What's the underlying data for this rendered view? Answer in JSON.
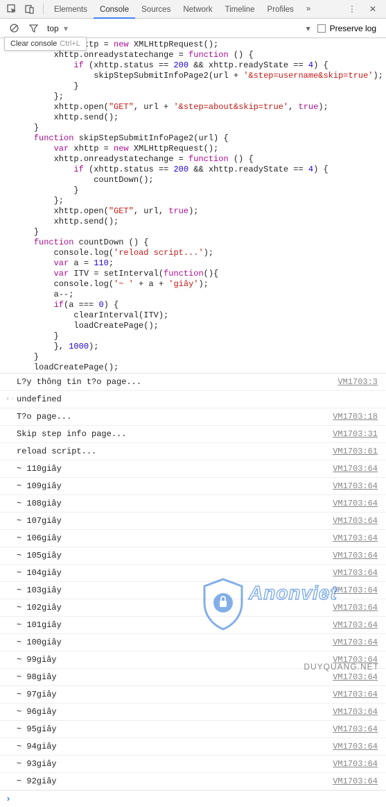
{
  "tabs": [
    "Elements",
    "Console",
    "Sources",
    "Network",
    "Timeline",
    "Profiles"
  ],
  "activeTab": 1,
  "toolbar": {
    "context": "top",
    "preserve_label": "Preserve log",
    "tooltip_label": "Clear console",
    "tooltip_shortcut": "Ctrl+L"
  },
  "code_lines": [
    {
      "indent": 2,
      "frags": [
        {
          "t": "var",
          "c": "kw"
        },
        {
          "t": " xhttp = "
        },
        {
          "t": "new",
          "c": "kw"
        },
        {
          "t": " XMLHttpRequest();"
        }
      ]
    },
    {
      "indent": 2,
      "frags": [
        {
          "t": "xhttp.onreadystatechange = "
        },
        {
          "t": "function",
          "c": "kw"
        },
        {
          "t": " () {"
        }
      ]
    },
    {
      "indent": 3,
      "frags": [
        {
          "t": "if",
          "c": "kw"
        },
        {
          "t": " (xhttp.status == "
        },
        {
          "t": "200",
          "c": "num"
        },
        {
          "t": " && xhttp.readyState == "
        },
        {
          "t": "4",
          "c": "num"
        },
        {
          "t": ") {"
        }
      ]
    },
    {
      "indent": 4,
      "frags": [
        {
          "t": "skipStepSubmitInfoPage2(url + "
        },
        {
          "t": "'&step=username&skip=true'",
          "c": "str"
        },
        {
          "t": ");"
        }
      ]
    },
    {
      "indent": 3,
      "frags": [
        {
          "t": "}"
        }
      ]
    },
    {
      "indent": 2,
      "frags": [
        {
          "t": "};"
        }
      ]
    },
    {
      "indent": 2,
      "frags": [
        {
          "t": "xhttp.open("
        },
        {
          "t": "\"GET\"",
          "c": "str"
        },
        {
          "t": ", url + "
        },
        {
          "t": "'&step=about&skip=true'",
          "c": "str"
        },
        {
          "t": ", "
        },
        {
          "t": "true",
          "c": "kw"
        },
        {
          "t": ");"
        }
      ]
    },
    {
      "indent": 2,
      "frags": [
        {
          "t": "xhttp.send();"
        }
      ]
    },
    {
      "indent": 1,
      "frags": [
        {
          "t": "}"
        }
      ]
    },
    {
      "indent": 1,
      "frags": [
        {
          "t": "function",
          "c": "kw"
        },
        {
          "t": " skipStepSubmitInfoPage2(url) {"
        }
      ]
    },
    {
      "indent": 2,
      "frags": [
        {
          "t": "var",
          "c": "kw"
        },
        {
          "t": " xhttp = "
        },
        {
          "t": "new",
          "c": "kw"
        },
        {
          "t": " XMLHttpRequest();"
        }
      ]
    },
    {
      "indent": 2,
      "frags": [
        {
          "t": "xhttp.onreadystatechange = "
        },
        {
          "t": "function",
          "c": "kw"
        },
        {
          "t": " () {"
        }
      ]
    },
    {
      "indent": 3,
      "frags": [
        {
          "t": "if",
          "c": "kw"
        },
        {
          "t": " (xhttp.status == "
        },
        {
          "t": "200",
          "c": "num"
        },
        {
          "t": " && xhttp.readyState == "
        },
        {
          "t": "4",
          "c": "num"
        },
        {
          "t": ") {"
        }
      ]
    },
    {
      "indent": 4,
      "frags": [
        {
          "t": "countDown();"
        }
      ]
    },
    {
      "indent": 3,
      "frags": [
        {
          "t": "}"
        }
      ]
    },
    {
      "indent": 2,
      "frags": [
        {
          "t": "};"
        }
      ]
    },
    {
      "indent": 2,
      "frags": [
        {
          "t": "xhttp.open("
        },
        {
          "t": "\"GET\"",
          "c": "str"
        },
        {
          "t": ", url, "
        },
        {
          "t": "true",
          "c": "kw"
        },
        {
          "t": ");"
        }
      ]
    },
    {
      "indent": 2,
      "frags": [
        {
          "t": "xhttp.send();"
        }
      ]
    },
    {
      "indent": 1,
      "frags": [
        {
          "t": "}"
        }
      ]
    },
    {
      "indent": 1,
      "frags": [
        {
          "t": "function",
          "c": "kw"
        },
        {
          "t": " countDown () {"
        }
      ]
    },
    {
      "indent": 2,
      "frags": [
        {
          "t": "console.log("
        },
        {
          "t": "'reload script...'",
          "c": "str"
        },
        {
          "t": ");"
        }
      ]
    },
    {
      "indent": 2,
      "frags": [
        {
          "t": "var",
          "c": "kw"
        },
        {
          "t": " a = "
        },
        {
          "t": "110",
          "c": "num"
        },
        {
          "t": ";"
        }
      ]
    },
    {
      "indent": 2,
      "frags": [
        {
          "t": "var",
          "c": "kw"
        },
        {
          "t": " ITV = setInterval("
        },
        {
          "t": "function",
          "c": "kw"
        },
        {
          "t": "(){"
        }
      ]
    },
    {
      "indent": 2,
      "frags": [
        {
          "t": "console.log("
        },
        {
          "t": "'~ '",
          "c": "str"
        },
        {
          "t": " + a + "
        },
        {
          "t": "'giây'",
          "c": "str"
        },
        {
          "t": ");"
        }
      ]
    },
    {
      "indent": 2,
      "frags": [
        {
          "t": "a--;"
        }
      ]
    },
    {
      "indent": 2,
      "frags": [
        {
          "t": "if",
          "c": "kw"
        },
        {
          "t": "(a === "
        },
        {
          "t": "0",
          "c": "num"
        },
        {
          "t": ") {"
        }
      ]
    },
    {
      "indent": 3,
      "frags": [
        {
          "t": "clearInterval(ITV);"
        }
      ]
    },
    {
      "indent": 3,
      "frags": [
        {
          "t": "loadCreatePage();"
        }
      ]
    },
    {
      "indent": 2,
      "frags": [
        {
          "t": "}"
        }
      ]
    },
    {
      "indent": 2,
      "frags": [
        {
          "t": "}, "
        },
        {
          "t": "1000",
          "c": "num"
        },
        {
          "t": ");"
        }
      ]
    },
    {
      "indent": 1,
      "frags": [
        {
          "t": "}"
        }
      ]
    },
    {
      "indent": 1,
      "frags": [
        {
          "t": "loadCreatePage();"
        }
      ]
    }
  ],
  "console": [
    {
      "msg": "L?y thông tin t?o page...",
      "src": "VM1703:3",
      "type": "log",
      "first": true
    },
    {
      "msg": "undefined",
      "src": "",
      "type": "ret"
    },
    {
      "msg": "T?o page...",
      "src": "VM1703:18",
      "type": "log"
    },
    {
      "msg": "Skip step info page...",
      "src": "VM1703:31",
      "type": "log"
    },
    {
      "msg": "reload script...",
      "src": "VM1703:61",
      "type": "log"
    },
    {
      "msg": "~ 110giây",
      "src": "VM1703:64",
      "type": "log"
    },
    {
      "msg": "~ 109giây",
      "src": "VM1703:64",
      "type": "log"
    },
    {
      "msg": "~ 108giây",
      "src": "VM1703:64",
      "type": "log"
    },
    {
      "msg": "~ 107giây",
      "src": "VM1703:64",
      "type": "log"
    },
    {
      "msg": "~ 106giây",
      "src": "VM1703:64",
      "type": "log"
    },
    {
      "msg": "~ 105giây",
      "src": "VM1703:64",
      "type": "log"
    },
    {
      "msg": "~ 104giây",
      "src": "VM1703:64",
      "type": "log"
    },
    {
      "msg": "~ 103giây",
      "src": "VM1703:64",
      "type": "log"
    },
    {
      "msg": "~ 102giây",
      "src": "VM1703:64",
      "type": "log"
    },
    {
      "msg": "~ 101giây",
      "src": "VM1703:64",
      "type": "log"
    },
    {
      "msg": "~ 100giây",
      "src": "VM1703:64",
      "type": "log"
    },
    {
      "msg": "~ 99giây",
      "src": "VM1703:64",
      "type": "log"
    },
    {
      "msg": "~ 98giây",
      "src": "VM1703:64",
      "type": "log"
    },
    {
      "msg": "~ 97giây",
      "src": "VM1703:64",
      "type": "log"
    },
    {
      "msg": "~ 96giây",
      "src": "VM1703:64",
      "type": "log"
    },
    {
      "msg": "~ 95giây",
      "src": "VM1703:64",
      "type": "log"
    },
    {
      "msg": "~ 94giây",
      "src": "VM1703:64",
      "type": "log"
    },
    {
      "msg": "~ 93giây",
      "src": "VM1703:64",
      "type": "log"
    },
    {
      "msg": "~ 92giây",
      "src": "VM1703:64",
      "type": "log"
    }
  ],
  "watermark": {
    "main": "Anonviet",
    "sub": "",
    "brand": "DUYQUANG.NET"
  }
}
